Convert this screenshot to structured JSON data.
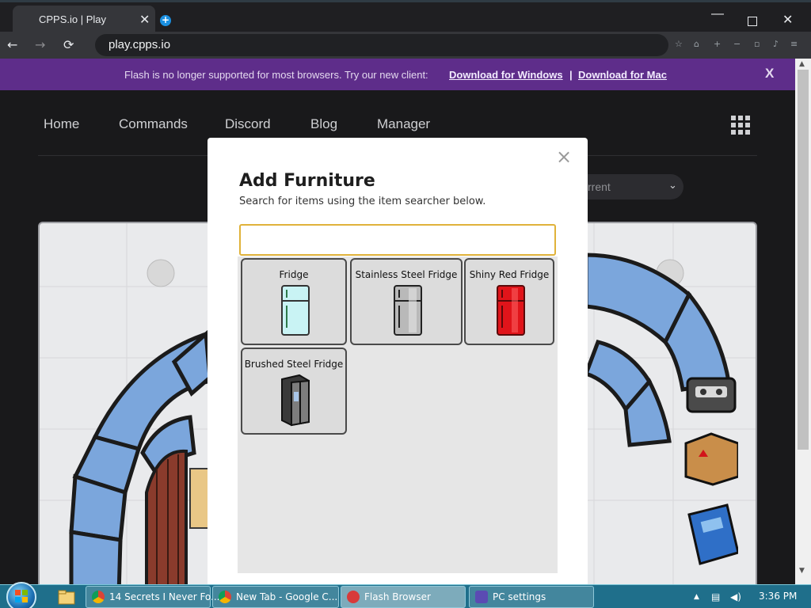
{
  "browser": {
    "tab_title": "CPPS.io | Play",
    "tab_close": "✕",
    "new_tab": "+",
    "url": "play.cpps.io",
    "back": "←",
    "forward": "→",
    "reload": "⟳",
    "window_min": "—",
    "window_close": "✕"
  },
  "banner": {
    "message": "Flash is no longer supported for most browsers. Try our new client:",
    "link_windows": "Download for Windows",
    "separator": "|",
    "link_mac": "Download for Mac",
    "close": "X"
  },
  "site_nav": {
    "items": [
      "Home",
      "Commands",
      "Discord",
      "Blog",
      "Manager"
    ],
    "server_select_value": "rrent",
    "server_select_chevron": "⌄",
    "apps_icon": "grid-icon"
  },
  "modal": {
    "title": "Add Furniture",
    "subtitle": "Search for items using the item searcher below.",
    "close": "×",
    "search_value": "",
    "search_placeholder": "",
    "items": [
      {
        "label": "Fridge",
        "color": "#c9f3f4"
      },
      {
        "label": "Stainless Steel Fridge",
        "color": "#b9b9b9"
      },
      {
        "label": "Shiny Red Fridge",
        "color": "#e0141a"
      },
      {
        "label": "Brushed Steel Fridge",
        "color": "#4a4a4a"
      }
    ]
  },
  "game_side_items": [
    "cassette-icon",
    "box-icon",
    "book-icon"
  ],
  "taskbar": {
    "tasks": [
      {
        "label": "14 Secrets I Never Fo...",
        "icon": "chrome-icon"
      },
      {
        "label": "New Tab - Google C...",
        "icon": "chrome-icon"
      },
      {
        "label": "Flash Browser",
        "icon": "flash-browser-icon",
        "active": true
      },
      {
        "label": "PC settings",
        "icon": "gear-icon"
      }
    ],
    "clock": "3:36 PM",
    "tray_up": "▲"
  },
  "scrollbar": {
    "up": "▲",
    "down": "▼"
  },
  "colors": {
    "banner": "#5e2d8a",
    "search_border": "#e0b23a",
    "taskbar": "#1f6f8b",
    "igloo_ice": "#6f9ed6"
  }
}
